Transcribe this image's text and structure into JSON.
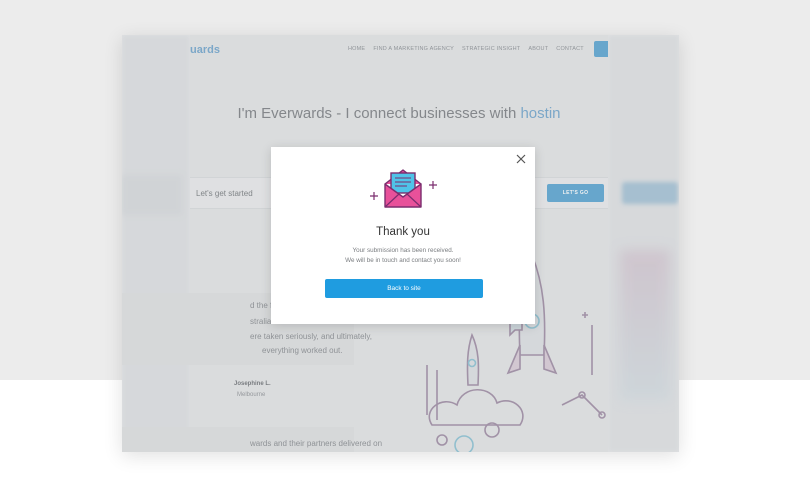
{
  "site": {
    "logo": "uards",
    "nav": [
      "HOME",
      "FIND A MARKETING AGENCY",
      "STRATEGIC INSIGHT",
      "ABOUT",
      "CONTACT"
    ],
    "hero_prefix": "I'm Everwards - I connect businesses with ",
    "hero_accent": "hostin",
    "form_label": "Let's get started",
    "cta_label": "LET'S GO",
    "testimonial_lines": [
      "d the fact that I coulc",
      "stralia as soon as I ca",
      "ere taken seriously, and ultimately,",
      "everything worked out."
    ],
    "author": "Josephine L.",
    "city": "Melbourne",
    "testimonial2_line": "wards and their partners delivered on"
  },
  "modal": {
    "title": "Thank you",
    "message_1": "Your submission has been received.",
    "message_2": "We will be in touch and contact you soon!",
    "button_label": "Back to site"
  },
  "colors": {
    "accent": "#1f9ce0",
    "envelope_pink": "#e8519a",
    "envelope_purple": "#7b2d6e",
    "letter_cyan": "#4fc3e8"
  }
}
